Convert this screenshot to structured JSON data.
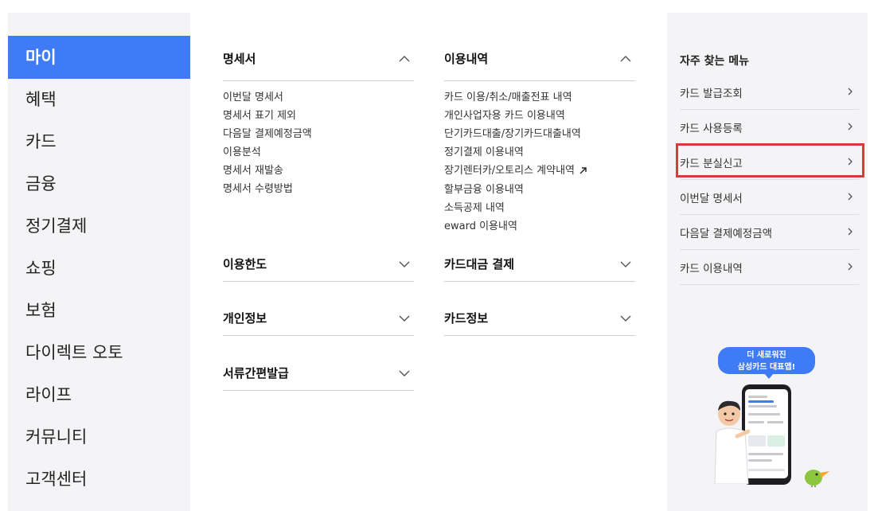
{
  "left_nav": {
    "items": [
      {
        "label": "마이",
        "active": true
      },
      {
        "label": "혜택"
      },
      {
        "label": "카드"
      },
      {
        "label": "금융"
      },
      {
        "label": "정기결제"
      },
      {
        "label": "쇼핑"
      },
      {
        "label": "보험"
      },
      {
        "label": "다이렉트 오토"
      },
      {
        "label": "라이프"
      },
      {
        "label": "커뮤니티"
      },
      {
        "label": "고객센터"
      }
    ],
    "accent_color": "#3e7bf4"
  },
  "sections": {
    "statement": {
      "title": "명세서",
      "expanded": true,
      "links": [
        "이번달 명세서",
        "명세서 표기 제외",
        "다음달 결제예정금액",
        "이용분석",
        "명세서 재발송",
        "명세서 수령방법"
      ]
    },
    "usage": {
      "title": "이용내역",
      "expanded": true,
      "links": [
        "카드 이용/취소/매출전표 내역",
        "개인사업자용 카드 이용내역",
        "단기카드대출/장기카드대출내역",
        "정기결제 이용내역",
        "장기렌터카/오토리스 계약내역",
        "할부금융 이용내역",
        "소득공제 내역",
        "eward 이용내역"
      ]
    },
    "limit": {
      "title": "이용한도",
      "expanded": false
    },
    "payment": {
      "title": "카드대금 결제",
      "expanded": false
    },
    "personal": {
      "title": "개인정보",
      "expanded": false
    },
    "cardinfo": {
      "title": "카드정보",
      "expanded": false
    },
    "docs": {
      "title": "서류간편발급",
      "expanded": false
    }
  },
  "favorites": {
    "title": "자주 찾는 메뉴",
    "items": [
      "카드 발급조회",
      "카드 사용등록",
      "카드 분실신고",
      "이번달 명세서",
      "다음달 결제예정금액",
      "카드 이용내역"
    ],
    "highlighted": "카드 분실신고",
    "highlight_color": "#d63a3a"
  },
  "promo": {
    "line1": "더 새로워진",
    "line2": "삼성카드 대표앱!"
  }
}
